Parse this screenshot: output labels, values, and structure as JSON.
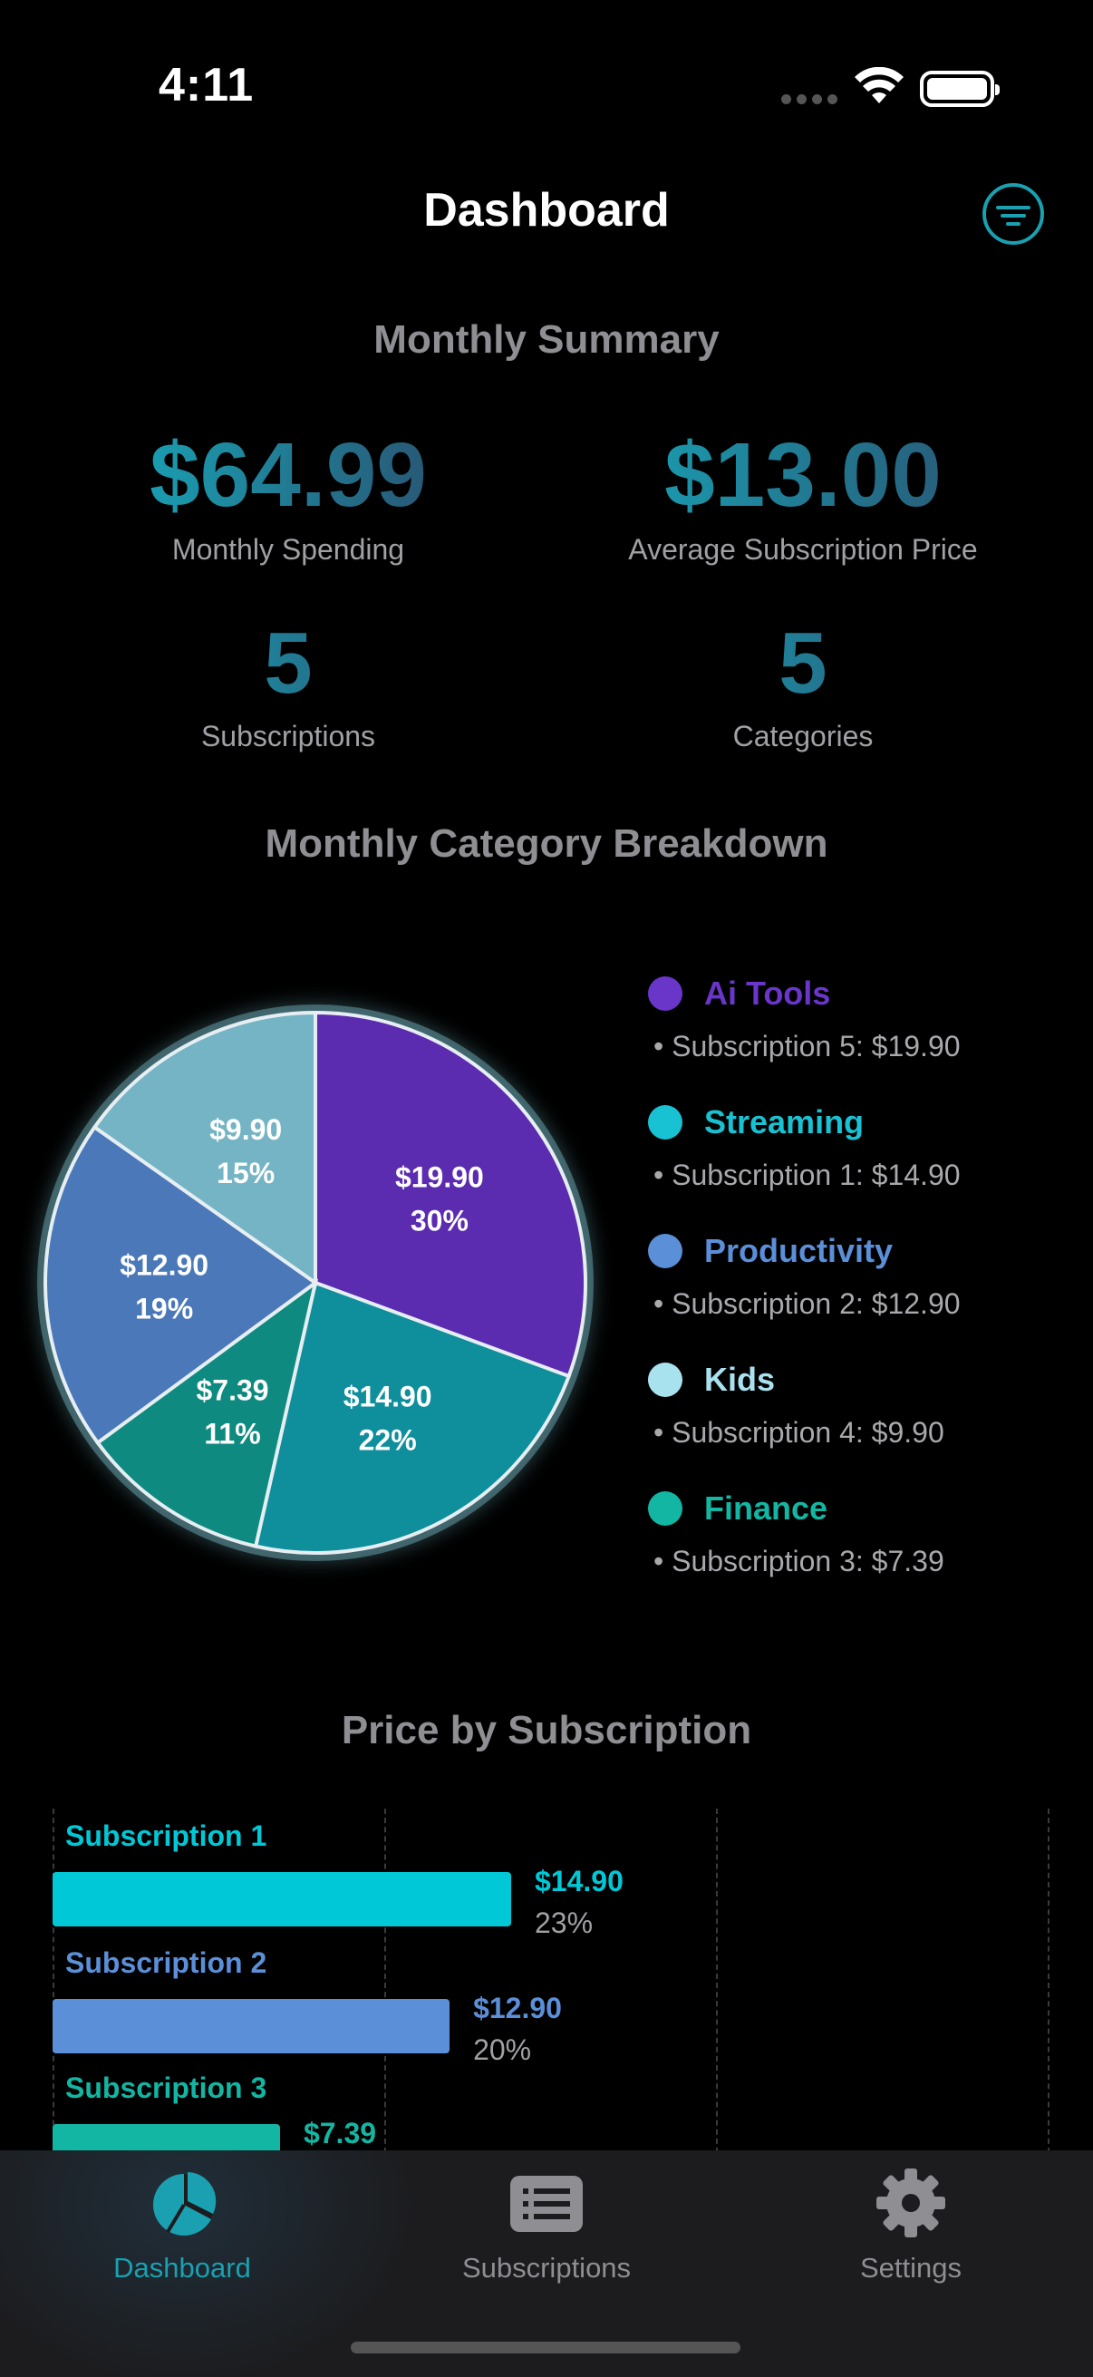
{
  "status_bar": {
    "time": "4:11"
  },
  "nav": {
    "title": "Dashboard"
  },
  "summary": {
    "title": "Monthly Summary",
    "monthly_spending": {
      "value": "$64.99",
      "label": "Monthly Spending"
    },
    "average_price": {
      "value": "$13.00",
      "label": "Average Subscription Price"
    },
    "subscriptions": {
      "value": "5",
      "label": "Subscriptions"
    },
    "categories": {
      "value": "5",
      "label": "Categories"
    }
  },
  "category_breakdown": {
    "title": "Monthly Category Breakdown",
    "slices": [
      {
        "category": "Ai Tools",
        "value": 19.9,
        "amount": "$19.90",
        "percent": "30%",
        "color": "#5b2bb0",
        "legend_color": "#6a35c9"
      },
      {
        "category": "Streaming",
        "value": 14.9,
        "amount": "$14.90",
        "percent": "22%",
        "color": "#0f8e9c",
        "legend_color": "#19c2d2"
      },
      {
        "category": "Finance",
        "value": 7.39,
        "amount": "$7.39",
        "percent": "11%",
        "color": "#0e8a80",
        "legend_color": "#13b5a3"
      },
      {
        "category": "Productivity",
        "value": 12.9,
        "amount": "$12.90",
        "percent": "19%",
        "color": "#4a78b8",
        "legend_color": "#5b8fd8"
      },
      {
        "category": "Kids",
        "value": 9.9,
        "amount": "$9.90",
        "percent": "15%",
        "color": "#74b4c4",
        "legend_color": "#a9e2ef"
      }
    ],
    "legend": [
      {
        "name": "Ai Tools",
        "color": "#6a35c9",
        "item": "• Subscription 5: $19.90"
      },
      {
        "name": "Streaming",
        "color": "#19c2d2",
        "item": "• Subscription 1: $14.90"
      },
      {
        "name": "Productivity",
        "color": "#5b8fd8",
        "item": "• Subscription 2: $12.90"
      },
      {
        "name": "Kids",
        "color": "#a9e2ef",
        "item": "• Subscription 4: $9.90"
      },
      {
        "name": "Finance",
        "color": "#13b5a3",
        "item": "• Subscription 3: $7.39"
      }
    ]
  },
  "price_by_subscription": {
    "title": "Price by Subscription",
    "bars": [
      {
        "name": "Subscription 1",
        "value": 14.9,
        "amount": "$14.90",
        "percent": "23%",
        "color": "#00c8d6"
      },
      {
        "name": "Subscription 2",
        "value": 12.9,
        "amount": "$12.90",
        "percent": "20%",
        "color": "#5b8fd8"
      },
      {
        "name": "Subscription 3",
        "value": 7.39,
        "amount": "$7.39",
        "percent": "",
        "color": "#13b5a3"
      }
    ]
  },
  "chart_data": [
    {
      "type": "pie",
      "title": "Monthly Category Breakdown",
      "categories": [
        "Ai Tools",
        "Streaming",
        "Finance",
        "Productivity",
        "Kids"
      ],
      "values": [
        19.9,
        14.9,
        7.39,
        12.9,
        9.9
      ],
      "percents": [
        30,
        22,
        11,
        19,
        15
      ]
    },
    {
      "type": "bar",
      "title": "Price by Subscription",
      "categories": [
        "Subscription 1",
        "Subscription 2",
        "Subscription 3"
      ],
      "values": [
        14.9,
        12.9,
        7.39
      ],
      "percents": [
        23,
        20,
        null
      ],
      "grid": true
    }
  ],
  "tab_bar": {
    "tabs": [
      {
        "label": "Dashboard",
        "icon": "pie-chart-icon",
        "active": true
      },
      {
        "label": "Subscriptions",
        "icon": "list-icon",
        "active": false
      },
      {
        "label": "Settings",
        "icon": "gear-icon",
        "active": false
      }
    ]
  },
  "accent_color": "#1aa0b0"
}
